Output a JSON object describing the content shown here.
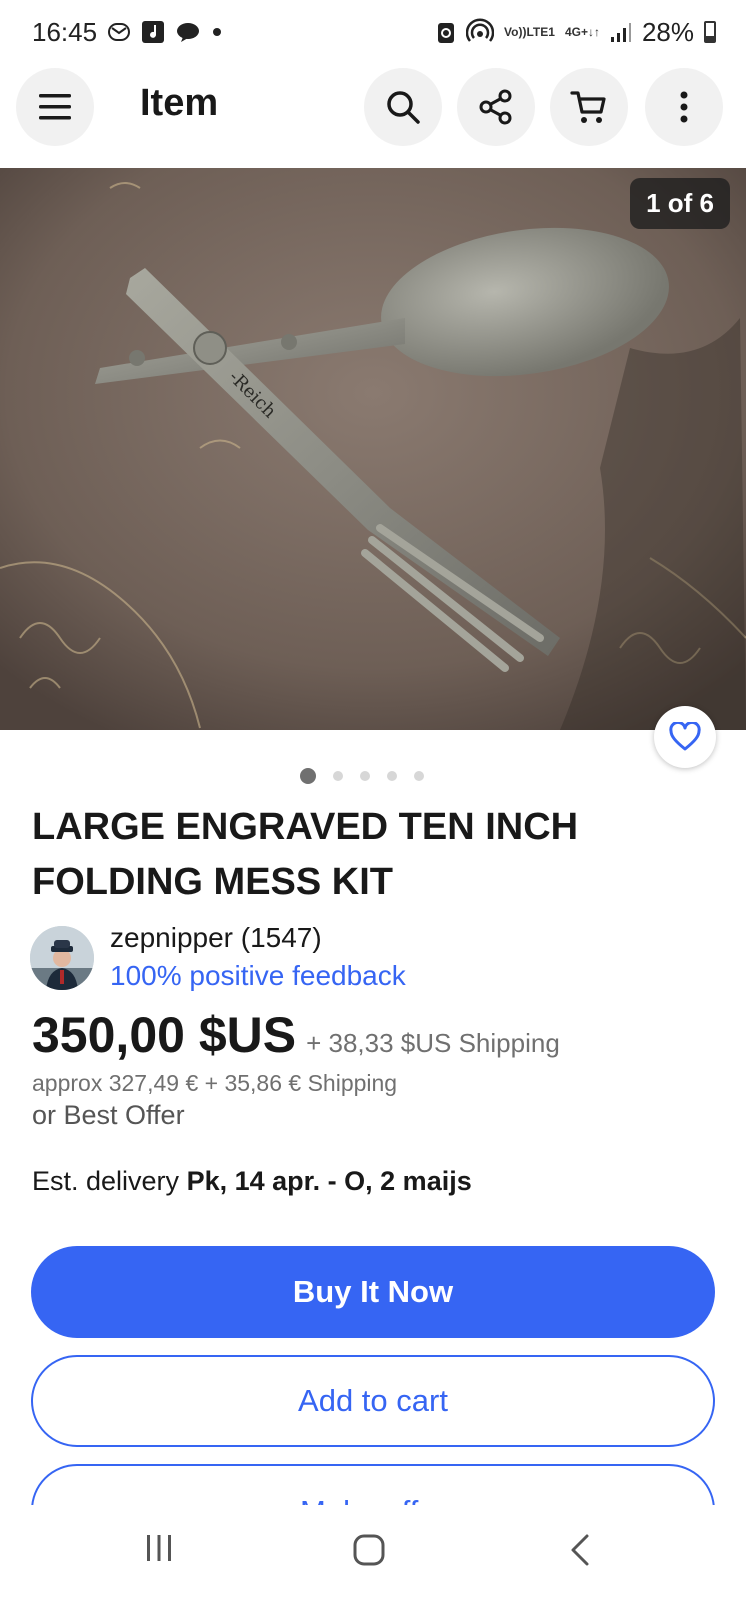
{
  "status_bar": {
    "time": "16:45",
    "network_top": "Vo)) ",
    "network_bottom": "LTE1",
    "network_gen": "4G+",
    "battery": "28%"
  },
  "app_bar": {
    "title": "Item",
    "icons": [
      "menu-icon",
      "search-icon",
      "share-icon",
      "cart-icon",
      "more-icon"
    ]
  },
  "gallery": {
    "counter": "1 of 6",
    "engraving": "-Reich",
    "dots_total": 5,
    "dots_active": 1
  },
  "listing": {
    "title": "LARGE ENGRAVED TEN INCH FOLDING MESS KIT",
    "seller_name": "zepnipper (1547)",
    "seller_feedback": "100% positive feedback",
    "price": "350,00 $US",
    "shipping": "+ 38,33 $US Shipping",
    "approx": "approx 327,49 € + 35,86 € Shipping",
    "best_offer": "or Best Offer",
    "delivery_label": "Est. delivery",
    "delivery_dates": "Pk, 14 apr. - O, 2 maijs"
  },
  "actions": {
    "buy_now": "Buy It Now",
    "add_to_cart": "Add to cart",
    "make_offer": "Make offer"
  },
  "colors": {
    "accent": "#3665f3",
    "text": "#191919",
    "secondary_text": "#707070"
  }
}
